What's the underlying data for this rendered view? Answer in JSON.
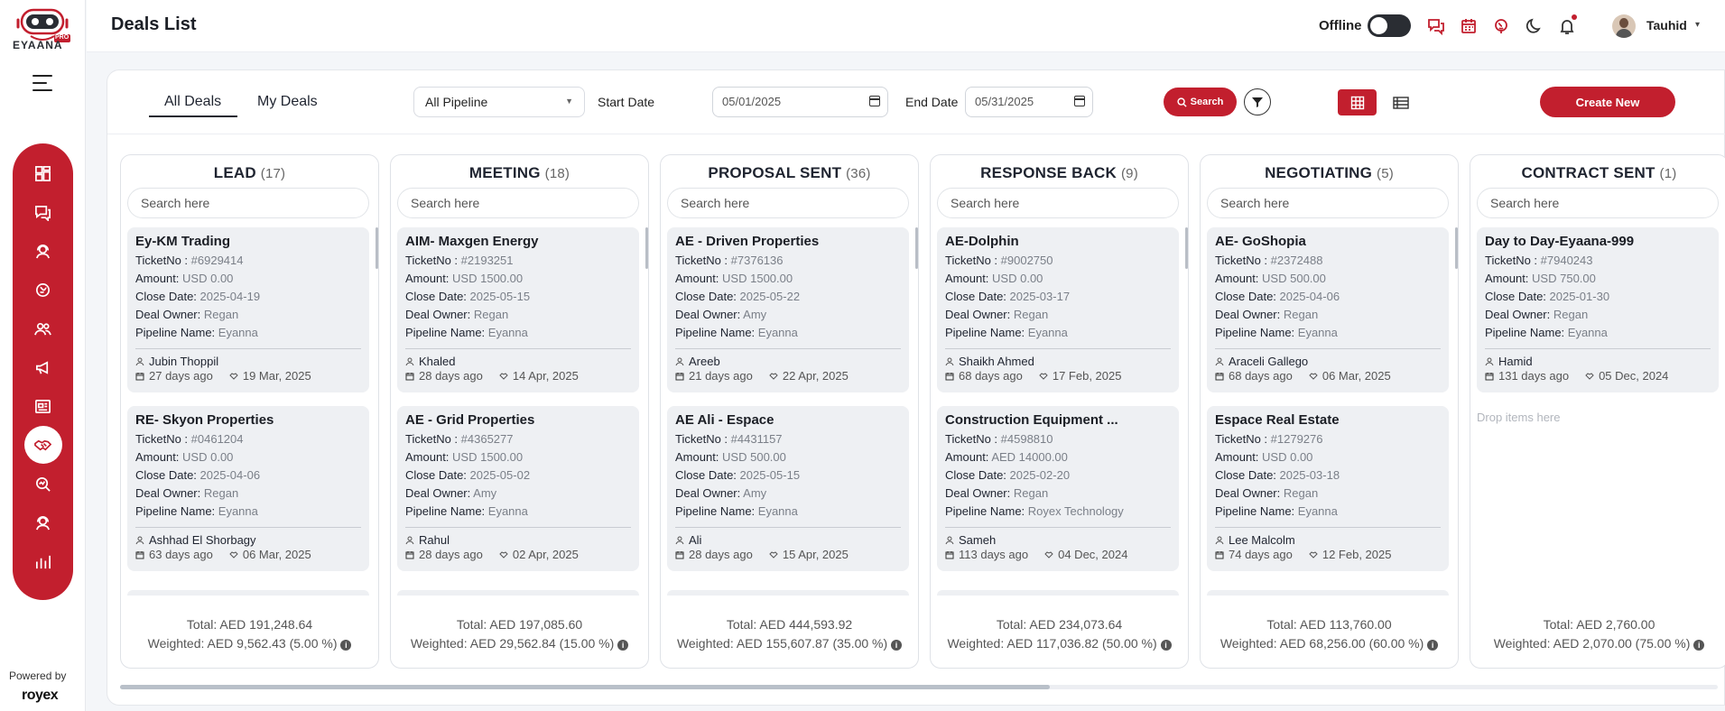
{
  "app": {
    "logo_text": "EYAANA",
    "logo_badge": "PRO",
    "powered_by": "Powered by",
    "powered_brand": "royex"
  },
  "sidebar": {
    "items": [
      {
        "icon": "dashboard-icon"
      },
      {
        "icon": "chat-icon"
      },
      {
        "icon": "support-agent-icon"
      },
      {
        "icon": "brain-icon"
      },
      {
        "icon": "users-icon"
      },
      {
        "icon": "megaphone-icon"
      },
      {
        "icon": "news-icon"
      },
      {
        "icon": "handshake-icon",
        "active": true
      },
      {
        "icon": "analytics-icon"
      },
      {
        "icon": "agent-icon"
      },
      {
        "icon": "bar-chart-icon"
      }
    ]
  },
  "header": {
    "title": "Deals List",
    "status_label": "Offline",
    "user_name": "Tauhid"
  },
  "toolbar": {
    "tabs": [
      "All Deals",
      "My Deals"
    ],
    "pipeline_select": "All Pipeline",
    "start_label": "Start Date",
    "start_value": "05/01/2025",
    "end_label": "End Date",
    "end_value": "05/31/2025",
    "search_label": "Search",
    "create_label": "Create New"
  },
  "colors": {
    "accent": "#c21f2e",
    "card_bg": "#eef0f3"
  },
  "columns": [
    {
      "name": "LEAD",
      "count": "(17)",
      "search_placeholder": "Search here",
      "total": "Total: AED 191,248.64",
      "weighted": "Weighted: AED 9,562.43 (5.00 %)",
      "cards": [
        {
          "title": "Ey-KM Trading",
          "ticket": "#6929414",
          "amount": "USD 0.00",
          "close": "2025-04-19",
          "owner": "Regan",
          "pipeline": "Eyanna",
          "contact": "Jubin Thoppil",
          "ago": "27 days ago",
          "date": "19 Mar, 2025"
        },
        {
          "title": "RE- Skyon Properties",
          "ticket": "#0461204",
          "amount": "USD 0.00",
          "close": "2025-04-06",
          "owner": "Regan",
          "pipeline": "Eyanna",
          "contact": "Ashhad El Shorbagy",
          "ago": "63 days ago",
          "date": "06 Mar, 2025"
        }
      ]
    },
    {
      "name": "MEETING",
      "count": "(18)",
      "search_placeholder": "Search here",
      "total": "Total: AED 197,085.60",
      "weighted": "Weighted: AED 29,562.84 (15.00 %)",
      "cards": [
        {
          "title": "AIM- Maxgen Energy",
          "ticket": "#2193251",
          "amount": "USD 1500.00",
          "close": "2025-05-15",
          "owner": "Regan",
          "pipeline": "Eyanna",
          "contact": "Khaled",
          "ago": "28 days ago",
          "date": "14 Apr, 2025"
        },
        {
          "title": "AE - Grid Properties",
          "ticket": "#4365277",
          "amount": "USD 1500.00",
          "close": "2025-05-02",
          "owner": "Amy",
          "pipeline": "Eyanna",
          "contact": "Rahul",
          "ago": "28 days ago",
          "date": "02 Apr, 2025"
        }
      ]
    },
    {
      "name": "PROPOSAL SENT",
      "count": "(36)",
      "search_placeholder": "Search here",
      "total": "Total: AED 444,593.92",
      "weighted": "Weighted: AED 155,607.87 (35.00 %)",
      "cards": [
        {
          "title": "AE - Driven Properties",
          "ticket": "#7376136",
          "amount": "USD 1500.00",
          "close": "2025-05-22",
          "owner": "Amy",
          "pipeline": "Eyanna",
          "contact": "Areeb",
          "ago": "21 days ago",
          "date": "22 Apr, 2025"
        },
        {
          "title": "AE Ali - Espace",
          "ticket": "#4431157",
          "amount": "USD 500.00",
          "close": "2025-05-15",
          "owner": "Amy",
          "pipeline": "Eyanna",
          "contact": "Ali",
          "ago": "28 days ago",
          "date": "15 Apr, 2025"
        }
      ]
    },
    {
      "name": "RESPONSE BACK",
      "count": "(9)",
      "search_placeholder": "Search here",
      "total": "Total: AED 234,073.64",
      "weighted": "Weighted: AED 117,036.82 (50.00 %)",
      "cards": [
        {
          "title": "AE-Dolphin",
          "ticket": "#9002750",
          "amount": "USD 0.00",
          "close": "2025-03-17",
          "owner": "Regan",
          "pipeline": "Eyanna",
          "contact": "Shaikh Ahmed",
          "ago": "68 days ago",
          "date": "17 Feb, 2025"
        },
        {
          "title": "Construction Equipment ...",
          "ticket": "#4598810",
          "amount": "AED 14000.00",
          "close": "2025-02-20",
          "owner": "Regan",
          "pipeline": "Royex Technology",
          "contact": "Sameh",
          "ago": "113 days ago",
          "date": "04 Dec, 2024"
        }
      ]
    },
    {
      "name": "NEGOTIATING",
      "count": "(5)",
      "search_placeholder": "Search here",
      "total": "Total: AED 113,760.00",
      "weighted": "Weighted: AED 68,256.00 (60.00 %)",
      "cards": [
        {
          "title": "AE- GoShopia",
          "ticket": "#2372488",
          "amount": "USD 500.00",
          "close": "2025-04-06",
          "owner": "Regan",
          "pipeline": "Eyanna",
          "contact": "Araceli Gallego",
          "ago": "68 days ago",
          "date": "06 Mar, 2025"
        },
        {
          "title": "Espace Real Estate",
          "ticket": "#1279276",
          "amount": "USD 0.00",
          "close": "2025-03-18",
          "owner": "Regan",
          "pipeline": "Eyanna",
          "contact": "Lee Malcolm",
          "ago": "74 days ago",
          "date": "12 Feb, 2025"
        }
      ]
    },
    {
      "name": "CONTRACT SENT",
      "count": "(1)",
      "search_placeholder": "Search here",
      "total": "Total: AED 2,760.00",
      "weighted": "Weighted: AED 2,070.00 (75.00 %)",
      "drop_text": "Drop items here",
      "cards": [
        {
          "title": "Day to Day-Eyaana-999",
          "ticket": "#7940243",
          "amount": "USD 750.00",
          "close": "2025-01-30",
          "owner": "Regan",
          "pipeline": "Eyanna",
          "contact": "Hamid",
          "ago": "131 days ago",
          "date": "05 Dec, 2024"
        }
      ]
    }
  ],
  "card_labels": {
    "ticket": "TicketNo :",
    "amount": "Amount:",
    "close": "Close Date:",
    "owner": "Deal Owner:",
    "pipeline": "Pipeline Name:"
  }
}
